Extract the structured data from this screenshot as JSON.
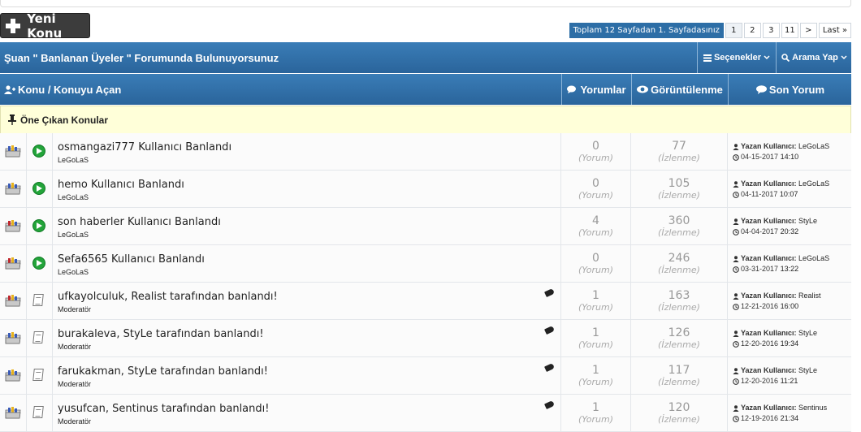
{
  "toolbar": {
    "new_topic_label": "Yeni Konu"
  },
  "pagination": {
    "info": "Toplam 12 Sayfadan 1. Sayfadasınız",
    "pages": [
      "1",
      "2",
      "3",
      "11",
      ">"
    ],
    "last_label": "Last »"
  },
  "forum_bar": {
    "title": "Şuan \" Banlanan Üyeler \" Forumunda Bulunuyorsunuz",
    "options_label": "Seçenekler",
    "search_label": "Arama Yap"
  },
  "table_header": {
    "topic": "Konu / Konuyu Açan",
    "replies": "Yorumlar",
    "views": "Görüntülenme",
    "last_post": "Son Yorum"
  },
  "sticky_header": "Öne Çıkan Konular",
  "labels": {
    "replies_unit": "(Yorum)",
    "views_unit": "(İzlenme)",
    "posted_by": "Yazan Kullanıcı:"
  },
  "topics": [
    {
      "title": "osmangazi777 Kullanıcı Banlandı",
      "author": "LeGoLaS",
      "replies": "0",
      "views": "77",
      "last_user": "LeGoLaS",
      "last_date": "04-15-2017",
      "last_time": "14:10",
      "status_icon": "arrow-right-icon",
      "folder_icon": "folder-blue-icon",
      "tagged": false
    },
    {
      "title": "hemo Kullanıcı Banlandı",
      "author": "LeGoLaS",
      "replies": "0",
      "views": "105",
      "last_user": "LeGoLaS",
      "last_date": "04-11-2017",
      "last_time": "10:07",
      "status_icon": "arrow-right-icon",
      "folder_icon": "folder-blue-icon",
      "tagged": false
    },
    {
      "title": "son haberler Kullanıcı Banlandı",
      "author": "LeGoLaS",
      "replies": "4",
      "views": "360",
      "last_user": "StyLe",
      "last_date": "04-04-2017",
      "last_time": "20:32",
      "status_icon": "arrow-right-icon",
      "folder_icon": "folder-red-icon",
      "tagged": false
    },
    {
      "title": "Sefa6565 Kullanıcı Banlandı",
      "author": "LeGoLaS",
      "replies": "0",
      "views": "246",
      "last_user": "LeGoLaS",
      "last_date": "03-31-2017",
      "last_time": "13:22",
      "status_icon": "arrow-right-icon",
      "folder_icon": "folder-red-icon",
      "tagged": false
    },
    {
      "title": "ufkayolculuk, Realist tarafından banlandı!",
      "author": "Moderatör",
      "replies": "1",
      "views": "163",
      "last_user": "Realist",
      "last_date": "12-21-2016",
      "last_time": "16:00",
      "status_icon": "document-icon",
      "folder_icon": "folder-red-icon",
      "tagged": true
    },
    {
      "title": "burakaleva, StyLe tarafından banlandı!",
      "author": "Moderatör",
      "replies": "1",
      "views": "126",
      "last_user": "StyLe",
      "last_date": "12-20-2016",
      "last_time": "19:34",
      "status_icon": "document-icon",
      "folder_icon": "folder-blue-icon",
      "tagged": true
    },
    {
      "title": "farukakman, StyLe tarafından banlandı!",
      "author": "Moderatör",
      "replies": "1",
      "views": "117",
      "last_user": "StyLe",
      "last_date": "12-20-2016",
      "last_time": "11:21",
      "status_icon": "document-icon",
      "folder_icon": "folder-blue-icon",
      "tagged": true
    },
    {
      "title": "yusufcan, Sentinus tarafından banlandı!",
      "author": "Moderatör",
      "replies": "1",
      "views": "120",
      "last_user": "Sentinus",
      "last_date": "12-19-2016",
      "last_time": "21:34",
      "status_icon": "document-icon",
      "folder_icon": "folder-blue-icon",
      "tagged": true
    }
  ],
  "colors": {
    "header_blue": "#2d6ea6",
    "sticky_bg": "#ffffd9",
    "arrow_green": "#23a43a"
  }
}
